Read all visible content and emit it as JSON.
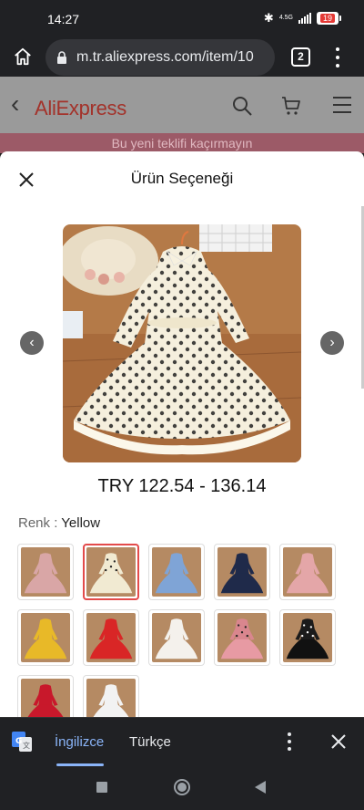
{
  "status_bar": {
    "time": "14:27",
    "network_label": "4.5G",
    "battery_level": "19"
  },
  "browser": {
    "url": "m.tr.aliexpress.com/item/10",
    "tab_count": "2"
  },
  "background_page": {
    "logo_text": "AliExpress",
    "promo_text": "Bu yeni teklifi kaçırmayın"
  },
  "sheet": {
    "title": "Ürün Seçeneği",
    "price": "TRY 122.54 - 136.14",
    "color_label": "Renk",
    "color_separator": " : ",
    "selected_color": "Yellow",
    "swatches": [
      {
        "color": "#d9a6a6",
        "pattern": "floral-pink"
      },
      {
        "color": "#f1ead2",
        "pattern": "dots-cream",
        "selected": true
      },
      {
        "color": "#7fa4d6",
        "pattern": "blue"
      },
      {
        "color": "#1f2a4a",
        "pattern": "navy"
      },
      {
        "color": "#e4a6a8",
        "pattern": "pink"
      },
      {
        "color": "#e8b928",
        "pattern": "yellow"
      },
      {
        "color": "#d92626",
        "pattern": "red"
      },
      {
        "color": "#f4f1ec",
        "pattern": "white"
      },
      {
        "color": "#d9868e",
        "pattern": "dots-black-pink"
      },
      {
        "color": "#1b1b1b",
        "pattern": "dots-black-white"
      },
      {
        "color": "#c8182b",
        "pattern": "red-tulle"
      },
      {
        "color": "#f2f2f2",
        "pattern": "white-2"
      }
    ]
  },
  "translate_bar": {
    "active_language": "İngilizce",
    "other_language": "Türkçe"
  },
  "icons": {
    "home": "home-icon",
    "lock": "lock-icon",
    "search": "search-icon",
    "cart": "cart-icon",
    "close": "close-icon",
    "prev": "chevron-left-icon",
    "next": "chevron-right-icon",
    "translate": "google-translate-icon"
  }
}
